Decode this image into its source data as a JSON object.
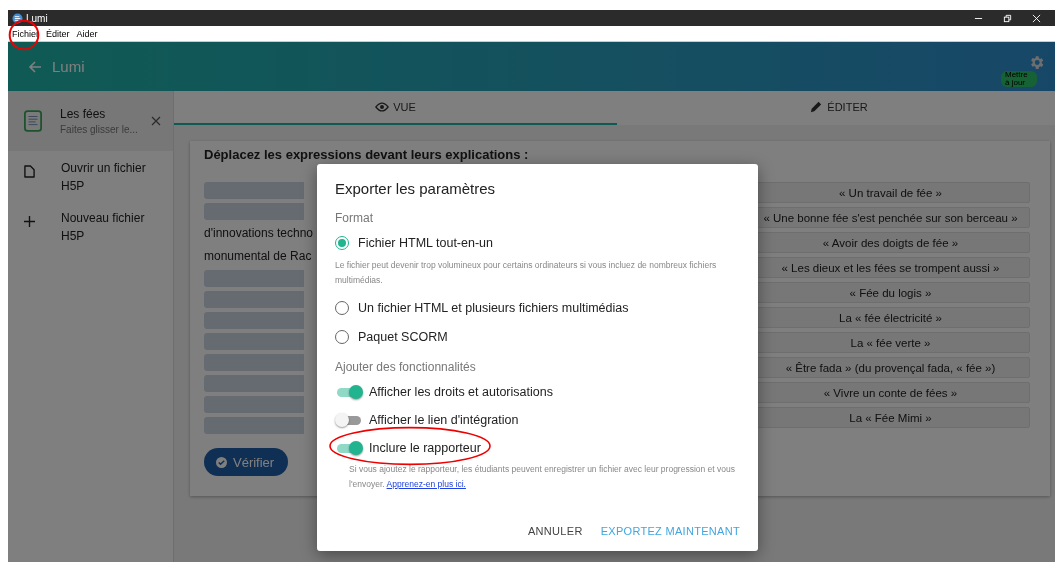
{
  "window": {
    "title": "Lumi"
  },
  "menu": [
    "Fichier",
    "Éditer",
    "Aider"
  ],
  "header": {
    "title": "Lumi",
    "update_badge": "Mettre à jour"
  },
  "sidebar": {
    "current_file": {
      "title": "Les fées",
      "subtitle": "Faites glisser le..."
    },
    "items": [
      {
        "kind": "file",
        "label": "Ouvrir un fichier H5P"
      },
      {
        "kind": "add",
        "label": "Nouveau fichier H5P"
      }
    ]
  },
  "tabs": [
    {
      "label": "VUE",
      "kind": "view",
      "selected": true
    },
    {
      "label": "ÉDITER",
      "kind": "edit",
      "selected": false
    }
  ],
  "exercise": {
    "instruction": "Déplacez les expressions devant leurs explications :",
    "text_lines": [
      "d'innovations techno",
      "monumental de Rac"
    ],
    "expressions": [
      "« Un travail de fée »",
      "« Une bonne fée s'est penchée sur son berceau »",
      "« Avoir des doigts de fée »",
      "« Les dieux et les fées se trompent aussi »",
      "« Fée du logis »",
      "La « fée électricité »",
      "La « fée verte »",
      "« Être fada » (du provençal fada, « fée »)",
      "« Vivre un conte de fées »",
      "La « Fée Mimi »"
    ],
    "check_button": "Vérifier"
  },
  "dialog": {
    "title": "Exporter les paramètres",
    "format_label": "Format",
    "options": [
      {
        "label": "Fichier HTML tout-en-un",
        "selected": true,
        "note": "Le fichier peut devenir trop volumineux pour certains ordinateurs si vous incluez de nombreux fichiers multimédias."
      },
      {
        "label": "Un fichier HTML et plusieurs fichiers multimédias",
        "selected": false
      },
      {
        "label": "Paquet SCORM",
        "selected": false
      }
    ],
    "features_label": "Ajouter des fonctionnalités",
    "toggles": [
      {
        "label": "Afficher les droits et autorisations",
        "on": true
      },
      {
        "label": "Afficher le lien d'intégration",
        "on": false
      },
      {
        "label": "Inclure le rapporteur",
        "on": true,
        "note": "Si vous ajoutez le rapporteur, les étudiants peuvent enregistrer un fichier avec leur progression et vous l'envoyer.",
        "link": "Apprenez-en plus ici."
      }
    ],
    "buttons": [
      {
        "label": "ANNULER",
        "kind": "cancel"
      },
      {
        "label": "EXPORTEZ MAINTENANT",
        "kind": "primary"
      }
    ]
  }
}
